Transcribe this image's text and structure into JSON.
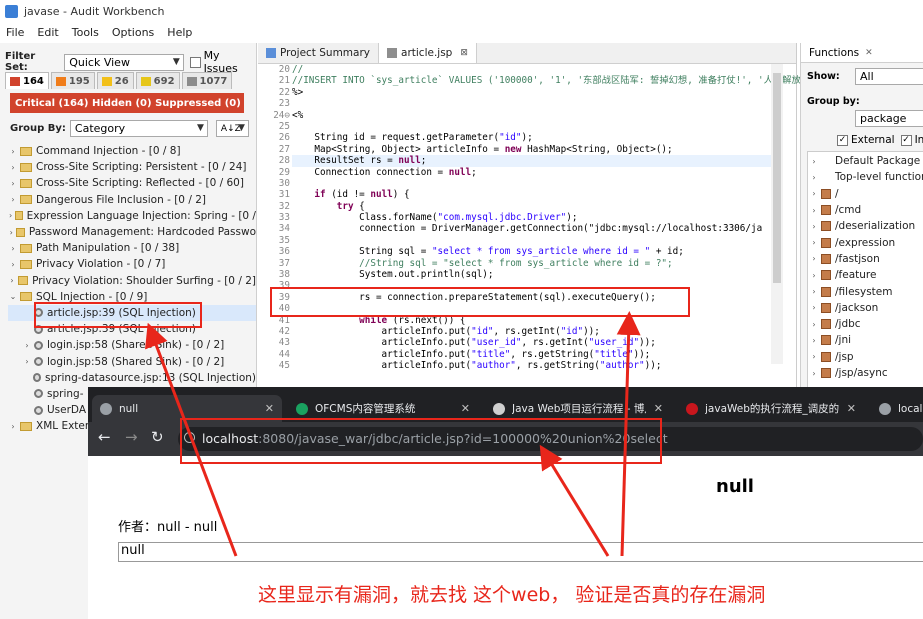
{
  "window": {
    "title": "javase - Audit Workbench"
  },
  "menu": [
    "File",
    "Edit",
    "Tools",
    "Options",
    "Help"
  ],
  "filter": {
    "label": "Filter Set:",
    "value": "Quick View",
    "my_issues": "My Issues"
  },
  "priority_tabs": [
    {
      "count": "164",
      "color": "#d1432c"
    },
    {
      "count": "195",
      "color": "#f07d1b"
    },
    {
      "count": "26",
      "color": "#f2c01a"
    },
    {
      "count": "692",
      "color": "#e6c619"
    },
    {
      "count": "1077",
      "color": "#8c8c8c"
    }
  ],
  "critical_bar": "Critical (164) Hidden (0) Suppressed (0)",
  "group_by": {
    "label": "Group By:",
    "value": "Category",
    "sort_icon": "A↓Z"
  },
  "tree": [
    {
      "label": "Command Injection - [0 / 8]",
      "type": "folder",
      "indent": 0
    },
    {
      "label": "Cross-Site Scripting: Persistent - [0 / 24]",
      "type": "folder",
      "indent": 0
    },
    {
      "label": "Cross-Site Scripting: Reflected - [0 / 60]",
      "type": "folder",
      "indent": 0
    },
    {
      "label": "Dangerous File Inclusion - [0 / 2]",
      "type": "folder",
      "indent": 0
    },
    {
      "label": "Expression Language Injection: Spring - [0 /",
      "type": "folder",
      "indent": 0
    },
    {
      "label": "Password Management: Hardcoded Passwo",
      "type": "folder",
      "indent": 0
    },
    {
      "label": "Path Manipulation - [0 / 38]",
      "type": "folder",
      "indent": 0
    },
    {
      "label": "Privacy Violation - [0 / 7]",
      "type": "folder",
      "indent": 0
    },
    {
      "label": "Privacy Violation: Shoulder Surfing - [0 / 2]",
      "type": "folder",
      "indent": 0
    },
    {
      "label": "SQL Injection - [0 / 9]",
      "type": "folder-open",
      "indent": 0
    },
    {
      "label": "article.jsp:39 (SQL Injection)",
      "type": "issue",
      "indent": 1,
      "selected": true
    },
    {
      "label": "article.jsp:39 (SQL Injection)",
      "type": "issue",
      "indent": 1
    },
    {
      "label": "login.jsp:58 (Shared Sink) - [0 / 2]",
      "type": "issue-group",
      "indent": 1
    },
    {
      "label": "login.jsp:58 (Shared Sink) - [0 / 2]",
      "type": "issue-group",
      "indent": 1
    },
    {
      "label": "spring-datasource.jsp:13 (SQL Injection)",
      "type": "issue",
      "indent": 1
    },
    {
      "label": "spring-",
      "type": "issue",
      "indent": 1
    },
    {
      "label": "UserDA",
      "type": "issue",
      "indent": 1
    },
    {
      "label": "XML Exter",
      "type": "folder",
      "indent": 0
    }
  ],
  "editor": {
    "tabs": [
      {
        "label": "Project Summary",
        "active": false
      },
      {
        "label": "article.jsp",
        "active": true,
        "close": "⊠"
      }
    ],
    "lines": [
      {
        "n": "20",
        "text": "//"
      },
      {
        "n": "21",
        "text": "//INSERT INTO `sys_article` VALUES ('100000', '1', '东部战区陆军: 誓掉幻想, 准备打仗!', '人民解放"
      },
      {
        "n": "22",
        "text": "%>"
      },
      {
        "n": "23",
        "text": ""
      },
      {
        "n": "24⊖",
        "text": "<%"
      },
      {
        "n": "25",
        "text": ""
      },
      {
        "n": "26",
        "text": "    String id = request.getParameter(\"id\");"
      },
      {
        "n": "27",
        "text": "    Map<String, Object> articleInfo = new HashMap<String, Object>();"
      },
      {
        "n": "28",
        "text": "    ResultSet rs = null;"
      },
      {
        "n": "29",
        "text": "    Connection connection = null;"
      },
      {
        "n": "30",
        "text": ""
      },
      {
        "n": "31",
        "text": "    if (id != null) {"
      },
      {
        "n": "32",
        "text": "        try {"
      },
      {
        "n": "33",
        "text": "            Class.forName(\"com.mysql.jdbc.Driver\");"
      },
      {
        "n": "34",
        "text": "            connection = DriverManager.getConnection(\"jdbc:mysql://localhost:3306/ja"
      },
      {
        "n": "35",
        "text": ""
      },
      {
        "n": "36",
        "text": "            String sql = \"select * from sys_article where id = \" + id;"
      },
      {
        "n": "37",
        "text": "            //String sql = \"select * from sys_article where id = ?\";"
      },
      {
        "n": "38",
        "text": "            System.out.println(sql);"
      },
      {
        "n": "39",
        "text": ""
      },
      {
        "n": "39",
        "text": "            rs = connection.prepareStatement(sql).executeQuery();"
      },
      {
        "n": "40",
        "text": ""
      },
      {
        "n": "41",
        "text": "            while (rs.next()) {"
      },
      {
        "n": "42",
        "text": "                articleInfo.put(\"id\", rs.getInt(\"id\"));"
      },
      {
        "n": "43",
        "text": "                articleInfo.put(\"user_id\", rs.getInt(\"user_id\"));"
      },
      {
        "n": "44",
        "text": "                articleInfo.put(\"title\", rs.getString(\"title\"));"
      },
      {
        "n": "45",
        "text": "                articleInfo.put(\"author\", rs.getString(\"author\"));"
      }
    ]
  },
  "functions": {
    "tab": "Functions",
    "show_label": "Show:",
    "show_value": "All",
    "groupby_label": "Group by:",
    "groupby_value": "package",
    "external": "External",
    "internal": "Inte",
    "items": [
      "Default Package",
      "Top-level function",
      "/",
      "/cmd",
      "/deserialization",
      "/expression",
      "/fastjson",
      "/feature",
      "/filesystem",
      "/jackson",
      "/jdbc",
      "/jni",
      "/jsp",
      "/jsp/async"
    ]
  },
  "browser": {
    "tabs": [
      {
        "label": "null",
        "active": true,
        "color": "#9aa0a6"
      },
      {
        "label": "OFCMS内容管理系统",
        "active": false,
        "color": "#1aa260"
      },
      {
        "label": "Java Web项目运行流程 - 博月亮",
        "active": false,
        "color": "#cfcfcf"
      },
      {
        "label": "javaWeb的执行流程_调皮的写代",
        "active": false,
        "color": "#c8161d"
      },
      {
        "label": "localh",
        "active": false,
        "color": "#9aa0a6"
      }
    ],
    "url_host": "localhost",
    "url_rest": ":8080/javase_war/jdbc/article.jsp?id=100000%20union%20select",
    "page_title": "null",
    "author_line": "作者：null - null",
    "content_box": "null"
  },
  "annotation": {
    "caption": "这里显示有漏洞，就去找 这个web， 验证是否真的存在漏洞"
  }
}
